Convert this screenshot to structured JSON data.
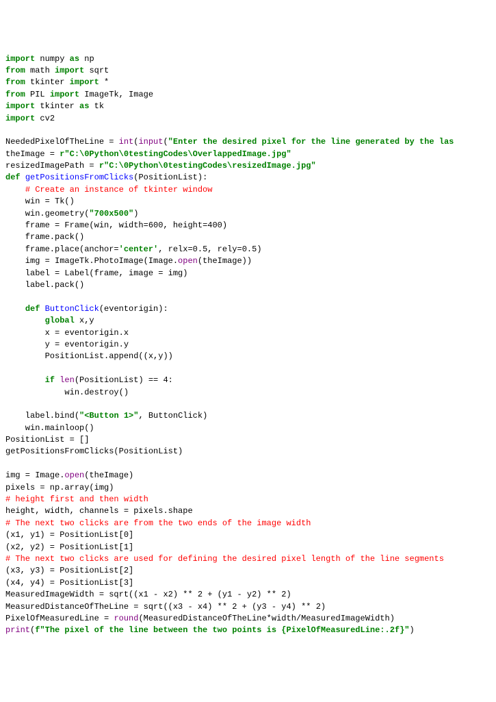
{
  "lines": [
    {
      "segments": [
        {
          "t": "import",
          "c": "kw"
        },
        {
          "t": " numpy ",
          "c": "name"
        },
        {
          "t": "as",
          "c": "kw"
        },
        {
          "t": " np",
          "c": "name"
        }
      ]
    },
    {
      "segments": [
        {
          "t": "from",
          "c": "kw"
        },
        {
          "t": " math ",
          "c": "name"
        },
        {
          "t": "import",
          "c": "kw"
        },
        {
          "t": " sqrt",
          "c": "name"
        }
      ]
    },
    {
      "segments": [
        {
          "t": "from",
          "c": "kw"
        },
        {
          "t": " tkinter ",
          "c": "name"
        },
        {
          "t": "import",
          "c": "kw"
        },
        {
          "t": " *",
          "c": "name"
        }
      ]
    },
    {
      "segments": [
        {
          "t": "from",
          "c": "kw"
        },
        {
          "t": " PIL ",
          "c": "name"
        },
        {
          "t": "import",
          "c": "kw"
        },
        {
          "t": " ImageTk, Image",
          "c": "name"
        }
      ]
    },
    {
      "segments": [
        {
          "t": "import",
          "c": "kw"
        },
        {
          "t": " tkinter ",
          "c": "name"
        },
        {
          "t": "as",
          "c": "kw"
        },
        {
          "t": " tk",
          "c": "name"
        }
      ]
    },
    {
      "segments": [
        {
          "t": "import",
          "c": "kw"
        },
        {
          "t": " cv2",
          "c": "name"
        }
      ]
    },
    {
      "segments": []
    },
    {
      "segments": [
        {
          "t": "NeededPixelOfTheLine = ",
          "c": "name"
        },
        {
          "t": "int",
          "c": "builtin"
        },
        {
          "t": "(",
          "c": "name"
        },
        {
          "t": "input",
          "c": "builtin"
        },
        {
          "t": "(",
          "c": "name"
        },
        {
          "t": "\"Enter the desired pixel for the line generated by the las",
          "c": "str"
        }
      ]
    },
    {
      "segments": [
        {
          "t": "theImage = ",
          "c": "name"
        },
        {
          "t": "r\"C:\\0Python\\0testingCodes\\OverlappedImage.jpg\"",
          "c": "raw-str"
        }
      ]
    },
    {
      "segments": [
        {
          "t": "resizedImagePath = ",
          "c": "name"
        },
        {
          "t": "r\"C:\\0Python\\0testingCodes\\resizedImage.jpg\"",
          "c": "raw-str"
        }
      ]
    },
    {
      "segments": [
        {
          "t": "def",
          "c": "kw"
        },
        {
          "t": " ",
          "c": "name"
        },
        {
          "t": "getPositionsFromClicks",
          "c": "func-def"
        },
        {
          "t": "(PositionList):",
          "c": "name"
        }
      ]
    },
    {
      "segments": [
        {
          "t": "    ",
          "c": "name"
        },
        {
          "t": "# Create an instance of tkinter window",
          "c": "comment"
        }
      ]
    },
    {
      "segments": [
        {
          "t": "    win = Tk()",
          "c": "name"
        }
      ]
    },
    {
      "segments": [
        {
          "t": "    win.geometry(",
          "c": "name"
        },
        {
          "t": "\"700x500\"",
          "c": "str"
        },
        {
          "t": ")",
          "c": "name"
        }
      ]
    },
    {
      "segments": [
        {
          "t": "    frame = Frame(win, width=",
          "c": "name"
        },
        {
          "t": "600",
          "c": "num"
        },
        {
          "t": ", height=",
          "c": "name"
        },
        {
          "t": "400",
          "c": "num"
        },
        {
          "t": ")",
          "c": "name"
        }
      ]
    },
    {
      "segments": [
        {
          "t": "    frame.pack()",
          "c": "name"
        }
      ]
    },
    {
      "segments": [
        {
          "t": "    frame.place(anchor=",
          "c": "name"
        },
        {
          "t": "'center'",
          "c": "str"
        },
        {
          "t": ", relx=",
          "c": "name"
        },
        {
          "t": "0.5",
          "c": "num"
        },
        {
          "t": ", rely=",
          "c": "name"
        },
        {
          "t": "0.5",
          "c": "num"
        },
        {
          "t": ")",
          "c": "name"
        }
      ]
    },
    {
      "segments": [
        {
          "t": "    img = ImageTk.PhotoImage(Image.",
          "c": "name"
        },
        {
          "t": "open",
          "c": "builtin"
        },
        {
          "t": "(theImage))",
          "c": "name"
        }
      ]
    },
    {
      "segments": [
        {
          "t": "    label = Label(frame, image = img)",
          "c": "name"
        }
      ]
    },
    {
      "segments": [
        {
          "t": "    label.pack()",
          "c": "name"
        }
      ]
    },
    {
      "segments": []
    },
    {
      "segments": [
        {
          "t": "    ",
          "c": "name"
        },
        {
          "t": "def",
          "c": "kw"
        },
        {
          "t": " ",
          "c": "name"
        },
        {
          "t": "ButtonClick",
          "c": "func-def"
        },
        {
          "t": "(eventorigin):",
          "c": "name"
        }
      ]
    },
    {
      "segments": [
        {
          "t": "        ",
          "c": "name"
        },
        {
          "t": "global",
          "c": "kw"
        },
        {
          "t": " x,y",
          "c": "name"
        }
      ]
    },
    {
      "segments": [
        {
          "t": "        x = eventorigin.x",
          "c": "name"
        }
      ]
    },
    {
      "segments": [
        {
          "t": "        y = eventorigin.y",
          "c": "name"
        }
      ]
    },
    {
      "segments": [
        {
          "t": "        PositionList.append((x,y))",
          "c": "name"
        }
      ]
    },
    {
      "segments": []
    },
    {
      "segments": [
        {
          "t": "        ",
          "c": "name"
        },
        {
          "t": "if",
          "c": "kw"
        },
        {
          "t": " ",
          "c": "name"
        },
        {
          "t": "len",
          "c": "builtin"
        },
        {
          "t": "(PositionList) == ",
          "c": "name"
        },
        {
          "t": "4",
          "c": "num"
        },
        {
          "t": ":",
          "c": "name"
        }
      ]
    },
    {
      "segments": [
        {
          "t": "            win.destroy()",
          "c": "name"
        }
      ]
    },
    {
      "segments": []
    },
    {
      "segments": [
        {
          "t": "    label.bind(",
          "c": "name"
        },
        {
          "t": "\"<Button 1>\"",
          "c": "str"
        },
        {
          "t": ", ButtonClick)",
          "c": "name"
        }
      ]
    },
    {
      "segments": [
        {
          "t": "    win.mainloop()",
          "c": "name"
        }
      ]
    },
    {
      "segments": [
        {
          "t": "PositionList = []",
          "c": "name"
        }
      ]
    },
    {
      "segments": [
        {
          "t": "getPositionsFromClicks(PositionList)",
          "c": "name"
        }
      ]
    },
    {
      "segments": []
    },
    {
      "segments": [
        {
          "t": "img = Image.",
          "c": "name"
        },
        {
          "t": "open",
          "c": "builtin"
        },
        {
          "t": "(theImage)",
          "c": "name"
        }
      ]
    },
    {
      "segments": [
        {
          "t": "pixels = np.array(img)",
          "c": "name"
        }
      ]
    },
    {
      "segments": [
        {
          "t": "# height first and then width",
          "c": "comment"
        }
      ]
    },
    {
      "segments": [
        {
          "t": "height, width, channels = pixels.shape",
          "c": "name"
        }
      ]
    },
    {
      "segments": [
        {
          "t": "# The next two clicks are from the two ends of the image width",
          "c": "comment"
        }
      ]
    },
    {
      "segments": [
        {
          "t": "(x1, y1) = PositionList[",
          "c": "name"
        },
        {
          "t": "0",
          "c": "num"
        },
        {
          "t": "]",
          "c": "name"
        }
      ]
    },
    {
      "segments": [
        {
          "t": "(x2, y2) = PositionList[",
          "c": "name"
        },
        {
          "t": "1",
          "c": "num"
        },
        {
          "t": "]",
          "c": "name"
        }
      ]
    },
    {
      "segments": [
        {
          "t": "# The next two clicks are used for defining the desired pixel length of the line segments",
          "c": "comment"
        }
      ]
    },
    {
      "segments": [
        {
          "t": "(x3, y3) = PositionList[",
          "c": "name"
        },
        {
          "t": "2",
          "c": "num"
        },
        {
          "t": "]",
          "c": "name"
        }
      ]
    },
    {
      "segments": [
        {
          "t": "(x4, y4) = PositionList[",
          "c": "name"
        },
        {
          "t": "3",
          "c": "num"
        },
        {
          "t": "]",
          "c": "name"
        }
      ]
    },
    {
      "segments": [
        {
          "t": "MeasuredImageWidth = sqrt((x1 - x2) ** ",
          "c": "name"
        },
        {
          "t": "2",
          "c": "num"
        },
        {
          "t": " + (y1 - y2) ** ",
          "c": "name"
        },
        {
          "t": "2",
          "c": "num"
        },
        {
          "t": ")",
          "c": "name"
        }
      ]
    },
    {
      "segments": [
        {
          "t": "MeasuredDistanceOfTheLine = sqrt((x3 - x4) ** ",
          "c": "name"
        },
        {
          "t": "2",
          "c": "num"
        },
        {
          "t": " + (y3 - y4) ** ",
          "c": "name"
        },
        {
          "t": "2",
          "c": "num"
        },
        {
          "t": ")",
          "c": "name"
        }
      ]
    },
    {
      "segments": [
        {
          "t": "PixelOfMeasuredLine = ",
          "c": "name"
        },
        {
          "t": "round",
          "c": "builtin"
        },
        {
          "t": "(MeasuredDistanceOfTheLine*width/MeasuredImageWidth)",
          "c": "name"
        }
      ]
    },
    {
      "segments": [
        {
          "t": "print",
          "c": "print-call"
        },
        {
          "t": "(",
          "c": "name"
        },
        {
          "t": "f\"The pixel of the line between the two points is {PixelOfMeasuredLine:.2f}\"",
          "c": "fstr"
        },
        {
          "t": ")",
          "c": "name"
        }
      ]
    }
  ]
}
